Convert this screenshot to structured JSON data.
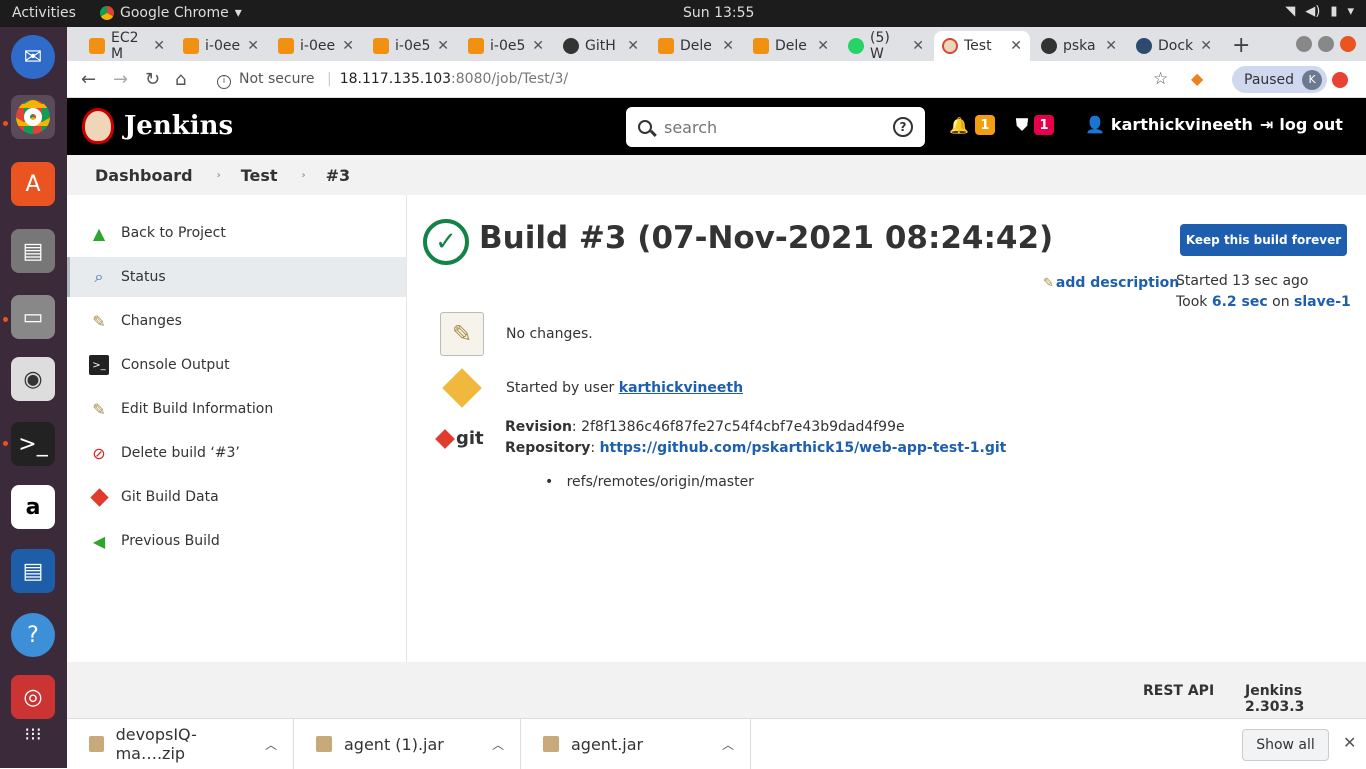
{
  "ubuntu": {
    "activities": "Activities",
    "app_name": "Google Chrome",
    "clock": "Sun 13:55"
  },
  "tabs": [
    {
      "label": "EC2 M",
      "color": "#f29111"
    },
    {
      "label": "i-0ee",
      "color": "#f29111"
    },
    {
      "label": "i-0ee",
      "color": "#f29111"
    },
    {
      "label": "i-0e5",
      "color": "#f29111"
    },
    {
      "label": "i-0e5",
      "color": "#f29111"
    },
    {
      "label": "GitH",
      "color": "#333333"
    },
    {
      "label": "Dele",
      "color": "#f29111"
    },
    {
      "label": "Dele",
      "color": "#f29111"
    },
    {
      "label": "(5) W",
      "color": "#25d366"
    },
    {
      "label": "Test",
      "color": "#d24939"
    },
    {
      "label": "pska",
      "color": "#333333"
    },
    {
      "label": "Dock",
      "color": "#2d4a6f"
    }
  ],
  "address_bar": {
    "security": "Not secure",
    "host": "18.117.135.103",
    "path": ":8080/job/Test/3/",
    "profile_status": "Paused",
    "profile_initial": "K"
  },
  "jenkins_header": {
    "brand": "Jenkins",
    "search_placeholder": "search",
    "help_icon": "?",
    "notifications_count": "1",
    "security_count": "1",
    "username": "karthickvineeth",
    "logout": "log out"
  },
  "breadcrumb": [
    "Dashboard",
    "Test",
    "#3"
  ],
  "sidebar": [
    {
      "label": "Back to Project",
      "icon": "up-arrow-icon"
    },
    {
      "label": "Status",
      "icon": "magnifier-icon"
    },
    {
      "label": "Changes",
      "icon": "notepad-icon"
    },
    {
      "label": "Console Output",
      "icon": "terminal-icon"
    },
    {
      "label": "Edit Build Information",
      "icon": "notepad-icon"
    },
    {
      "label": "Delete build ‘#3’",
      "icon": "no-entry-icon"
    },
    {
      "label": "Git Build Data",
      "icon": "git-icon"
    },
    {
      "label": "Previous Build",
      "icon": "left-arrow-icon"
    }
  ],
  "build": {
    "title": "Build #3 (07-Nov-2021 08:24:42)",
    "keep_forever": "Keep this build forever",
    "add_description": "add description",
    "started": "Started 13 sec ago",
    "took_prefix": "Took",
    "took_value": "6.2 sec",
    "on_word": "on",
    "agent": "slave-1",
    "changes": "No changes.",
    "started_by_prefix": "Started by user",
    "started_by_user": "karthickvineeth",
    "revision_label": "Revision",
    "revision": "2f8f1386c46f87fe27c54f4cbf7e43b9dad4f99e",
    "repository_label": "Repository",
    "repository": "https://github.com/pskarthick15/web-app-test-1.git",
    "ref": "refs/remotes/origin/master",
    "git_logo_text": "git"
  },
  "footer": {
    "rest_api": "REST API",
    "version": "Jenkins 2.303.3"
  },
  "downloads": {
    "items": [
      "devopsIQ-ma….zip",
      "agent (1).jar",
      "agent.jar"
    ],
    "show_all": "Show all"
  }
}
